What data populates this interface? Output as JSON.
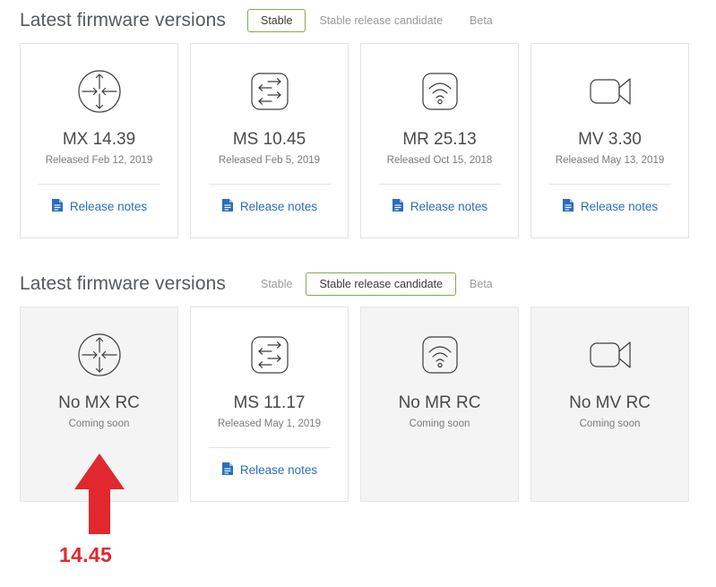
{
  "colors": {
    "accent_green": "#87a951",
    "link_blue": "#2a6ebb",
    "annotation_red": "#e0282e",
    "card_border": "#e0e2e4",
    "muted_card_bg": "#f4f4f4",
    "title_gray": "#555a5f",
    "body_gray": "#7b7b7b"
  },
  "sections": [
    {
      "id": "stable",
      "title": "Latest firmware versions",
      "tabs": [
        {
          "label": "Stable",
          "selected": true
        },
        {
          "label": "Stable release candidate",
          "selected": false
        },
        {
          "label": "Beta",
          "selected": false
        }
      ],
      "cards": [
        {
          "icon": "router-icon",
          "version": "MX 14.39",
          "sub": "Released Feb 12, 2019",
          "link": "Release notes",
          "has_link": true,
          "muted": false
        },
        {
          "icon": "switch-icon",
          "version": "MS 10.45",
          "sub": "Released Feb 5, 2019",
          "link": "Release notes",
          "has_link": true,
          "muted": false
        },
        {
          "icon": "wifi-access-point-icon",
          "version": "MR 25.13",
          "sub": "Released Oct 15, 2018",
          "link": "Release notes",
          "has_link": true,
          "muted": false
        },
        {
          "icon": "video-camera-icon",
          "version": "MV 3.30",
          "sub": "Released May 13, 2019",
          "link": "Release notes",
          "has_link": true,
          "muted": false
        }
      ]
    },
    {
      "id": "rc",
      "title": "Latest firmware versions",
      "tabs": [
        {
          "label": "Stable",
          "selected": false
        },
        {
          "label": "Stable release candidate",
          "selected": true
        },
        {
          "label": "Beta",
          "selected": false
        }
      ],
      "cards": [
        {
          "icon": "router-icon",
          "version": "No MX RC",
          "sub": "Coming soon",
          "link": "",
          "has_link": false,
          "muted": true
        },
        {
          "icon": "switch-icon",
          "version": "MS 11.17",
          "sub": "Released May 1, 2019",
          "link": "Release notes",
          "has_link": true,
          "muted": false
        },
        {
          "icon": "wifi-access-point-icon",
          "version": "No MR RC",
          "sub": "Coming soon",
          "link": "",
          "has_link": false,
          "muted": true
        },
        {
          "icon": "video-camera-icon",
          "version": "No MV RC",
          "sub": "Coming soon",
          "link": "",
          "has_link": false,
          "muted": true
        }
      ]
    }
  ],
  "annotation": {
    "icon": "up-arrow-annotation",
    "label": "14.45"
  }
}
